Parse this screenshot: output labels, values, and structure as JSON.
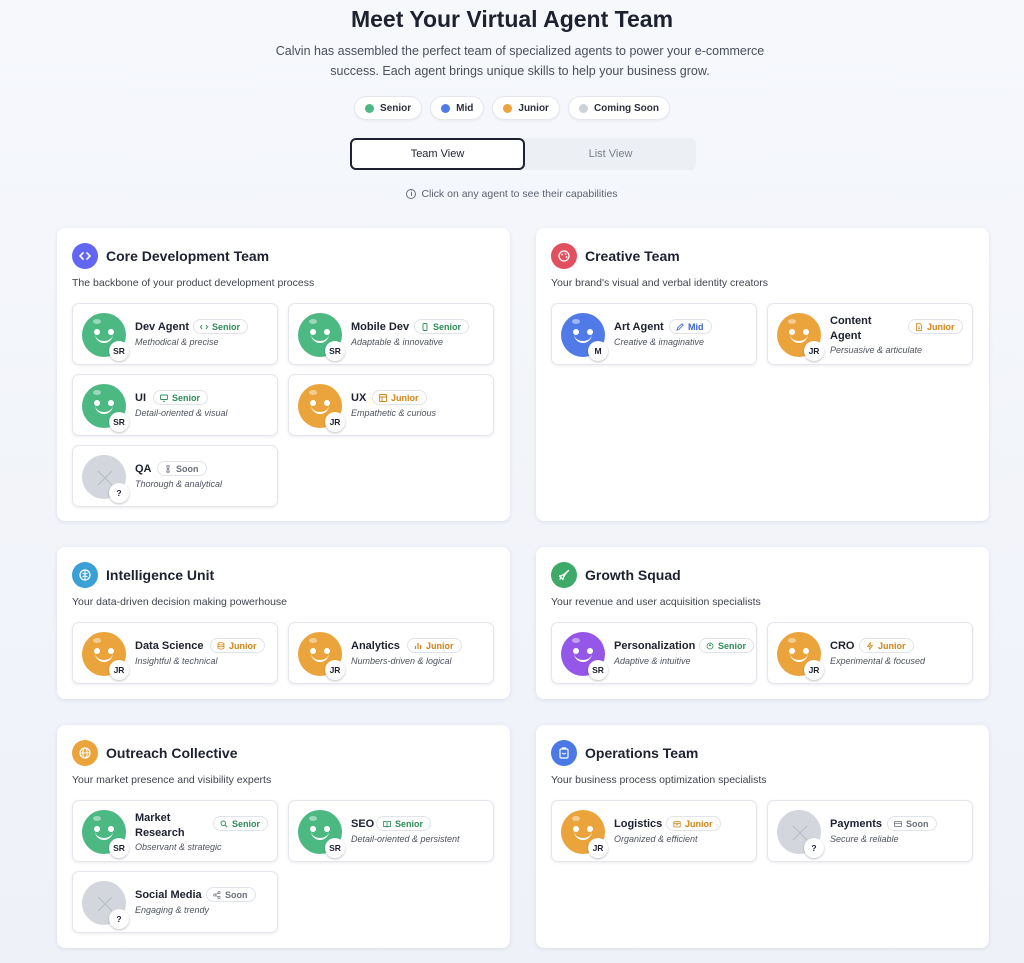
{
  "header": {
    "title": "Meet Your Virtual Agent Team",
    "subtitle": "Calvin has assembled the perfect team of specialized agents to power your e-commerce success. Each agent brings unique skills to help your business grow."
  },
  "legend": [
    {
      "label": "Senior",
      "color": "#4cb882"
    },
    {
      "label": "Mid",
      "color": "#4f7ae8"
    },
    {
      "label": "Junior",
      "color": "#eba43c"
    },
    {
      "label": "Coming Soon",
      "color": "#cfd2d8"
    }
  ],
  "view_toggle": {
    "team": "Team View",
    "list": "List View",
    "active": "team"
  },
  "hint": "Click on any agent to see their capabilities",
  "colors": {
    "senior": "#4cb882",
    "mid": "#4f7ae8",
    "junior": "#eba43c",
    "soon": "#d3d6dc",
    "personalization": "#9457e8"
  },
  "teams": {
    "core": {
      "title": "Core Development Team",
      "desc": "The backbone of your product development process",
      "icon": "code-icon",
      "icon_color": "#6366f1",
      "agents": [
        {
          "name": "Dev Agent",
          "trait": "Methodical & precise",
          "badge": "Senior",
          "level": "SR"
        },
        {
          "name": "Mobile Dev",
          "trait": "Adaptable & innovative",
          "badge": "Senior",
          "level": "SR"
        },
        {
          "name": "UI",
          "trait": "Detail-oriented & visual",
          "badge": "Senior",
          "level": "SR"
        },
        {
          "name": "UX",
          "trait": "Empathetic & curious",
          "badge": "Junior",
          "level": "JR"
        },
        {
          "name": "QA",
          "trait": "Thorough & analytical",
          "badge": "Soon",
          "level": "?"
        }
      ]
    },
    "creative": {
      "title": "Creative Team",
      "desc": "Your brand's visual and verbal identity creators",
      "icon": "palette-icon",
      "icon_color": "#e0505e",
      "agents": [
        {
          "name": "Art Agent",
          "trait": "Creative & imaginative",
          "badge": "Mid",
          "level": "M"
        },
        {
          "name": "Content Agent",
          "trait": "Persuasive & articulate",
          "badge": "Junior",
          "level": "JR"
        }
      ]
    },
    "intelligence": {
      "title": "Intelligence Unit",
      "desc": "Your data-driven decision making powerhouse",
      "icon": "brain-icon",
      "icon_color": "#3aa0d6",
      "agents": [
        {
          "name": "Data Science",
          "trait": "Insightful & technical",
          "badge": "Junior",
          "level": "JR"
        },
        {
          "name": "Analytics",
          "trait": "Numbers-driven & logical",
          "badge": "Junior",
          "level": "JR"
        }
      ]
    },
    "growth": {
      "title": "Growth Squad",
      "desc": "Your revenue and user acquisition specialists",
      "icon": "rocket-icon",
      "icon_color": "#3eaa6a",
      "agents": [
        {
          "name": "Personalization",
          "trait": "Adaptive & intuitive",
          "badge": "Senior",
          "level": "SR"
        },
        {
          "name": "CRO",
          "trait": "Experimental & focused",
          "badge": "Junior",
          "level": "JR"
        }
      ]
    },
    "outreach": {
      "title": "Outreach Collective",
      "desc": "Your market presence and visibility experts",
      "icon": "globe-icon",
      "icon_color": "#eba43c",
      "agents": [
        {
          "name": "Market Research",
          "trait": "Observant & strategic",
          "badge": "Senior",
          "level": "SR"
        },
        {
          "name": "SEO",
          "trait": "Detail-oriented & persistent",
          "badge": "Senior",
          "level": "SR"
        },
        {
          "name": "Social Media",
          "trait": "Engaging & trendy",
          "badge": "Soon",
          "level": "?"
        }
      ]
    },
    "operations": {
      "title": "Operations Team",
      "desc": "Your business process optimization specialists",
      "icon": "clipboard-icon",
      "icon_color": "#4a78e6",
      "agents": [
        {
          "name": "Logistics",
          "trait": "Organized & efficient",
          "badge": "Junior",
          "level": "JR"
        },
        {
          "name": "Payments",
          "trait": "Secure & reliable",
          "badge": "Soon",
          "level": "?"
        }
      ]
    }
  }
}
